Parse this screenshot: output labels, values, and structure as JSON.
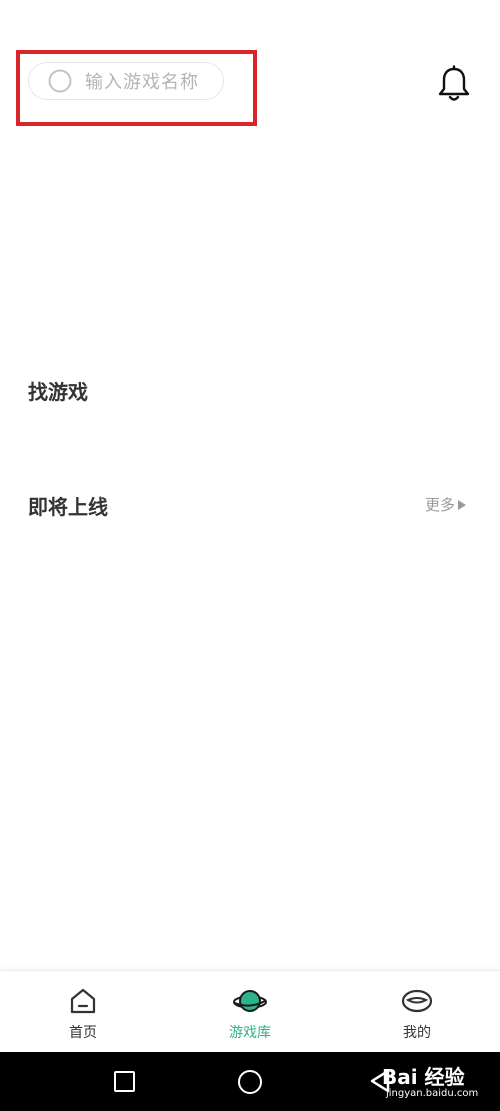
{
  "search": {
    "placeholder": "输入游戏名称"
  },
  "sections": {
    "find_games": "找游戏",
    "coming_soon": "即将上线",
    "more": "更多"
  },
  "tabbar": {
    "items": [
      {
        "label": "首页",
        "icon": "home-icon",
        "active": false
      },
      {
        "label": "游戏库",
        "icon": "planet-icon",
        "active": true
      },
      {
        "label": "我的",
        "icon": "profile-icon",
        "active": false
      }
    ]
  },
  "colors": {
    "accent": "#2bb38a",
    "highlight": "#d9262c",
    "navbar": "#000000"
  },
  "watermark": {
    "logo": "Bai 经验",
    "url": "jingyan.baidu.com"
  }
}
